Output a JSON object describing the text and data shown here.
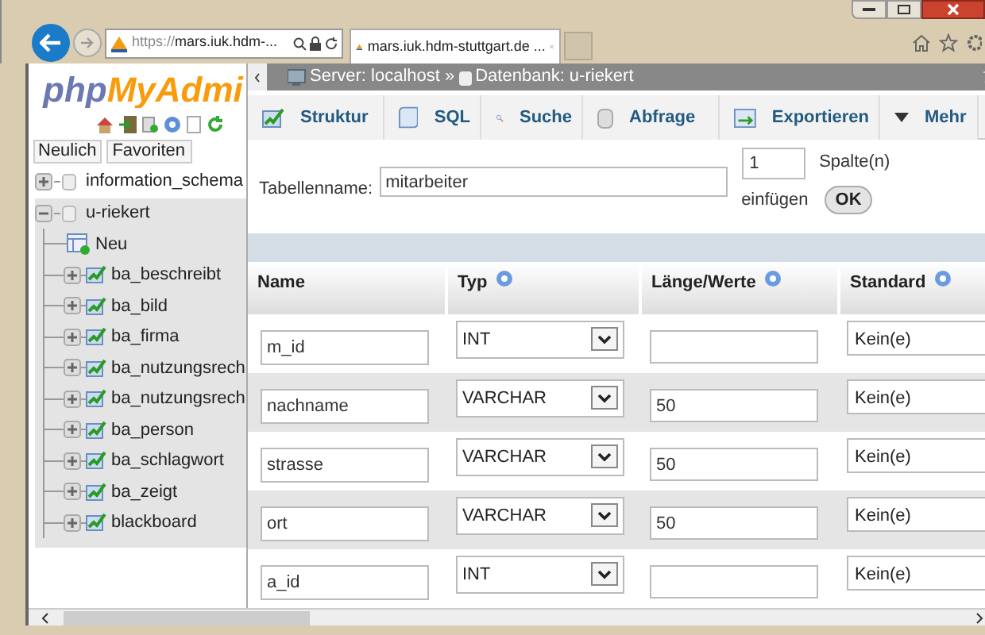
{
  "browser": {
    "address": "https://mars.iuk.hdm-...",
    "tab": {
      "title": "mars.iuk.hdm-stuttgart.de ...",
      "selected": true
    }
  },
  "sidebar": {
    "logo": {
      "part_1": "php",
      "part_2": "MyAdmi"
    },
    "buttons": [
      "Neulich",
      "Favoriten"
    ],
    "tree": [
      {
        "label": "information_schema",
        "expanded": false
      },
      {
        "label": "u-riekert",
        "expanded": true,
        "children": [
          {
            "label": "Neu",
            "kind": "new"
          },
          {
            "label": "ba_beschreibt",
            "kind": "table"
          },
          {
            "label": "ba_bild",
            "kind": "table"
          },
          {
            "label": "ba_firma",
            "kind": "table"
          },
          {
            "label": "ba_nutzungsrech",
            "kind": "table"
          },
          {
            "label": "ba_nutzungsrech",
            "kind": "table"
          },
          {
            "label": "ba_person",
            "kind": "table"
          },
          {
            "label": "ba_schlagwort",
            "kind": "table"
          },
          {
            "label": "ba_zeigt",
            "kind": "table"
          },
          {
            "label": "blackboard",
            "kind": "table"
          }
        ]
      }
    ]
  },
  "breadcrumb": {
    "server": "Server: localhost »",
    "database": "Datenbank: u-riekert"
  },
  "tabs": [
    {
      "label": "Struktur",
      "kind": "structure",
      "selected": false
    },
    {
      "label": "SQL",
      "kind": "sql",
      "selected": false
    },
    {
      "label": "Suche",
      "kind": "search",
      "selected": false
    },
    {
      "label": "Abfrage",
      "kind": "query",
      "selected": false
    },
    {
      "label": "Exportieren",
      "kind": "export",
      "selected": false
    },
    {
      "label": "Mehr",
      "kind": "more",
      "selected": false
    }
  ],
  "form": {
    "table_name_label": "Tabellenname:",
    "table_name": "mitarbeiter",
    "count": "1",
    "count_unit": "Spalte(n)",
    "add_label": "einfügen",
    "ok": "OK"
  },
  "table": {
    "columns": [
      {
        "label": "Name",
        "help": false
      },
      {
        "label": "Typ",
        "help": true
      },
      {
        "label": "Länge/Werte",
        "help": true
      },
      {
        "label": "Standard",
        "help": true
      }
    ],
    "rows": [
      {
        "name": "m_id",
        "type": "INT",
        "default": "Kein(e)"
      },
      {
        "name": "nachname",
        "type": "VARCHAR",
        "length": "50",
        "default": "Kein(e)"
      },
      {
        "name": "strasse",
        "type": "VARCHAR",
        "length": "50",
        "default": "Kein(e)"
      },
      {
        "name": "ort",
        "type": "VARCHAR",
        "length": "50",
        "default": "Kein(e)"
      },
      {
        "name": "a_id",
        "type": "INT",
        "default": "Kein(e)"
      }
    ]
  }
}
